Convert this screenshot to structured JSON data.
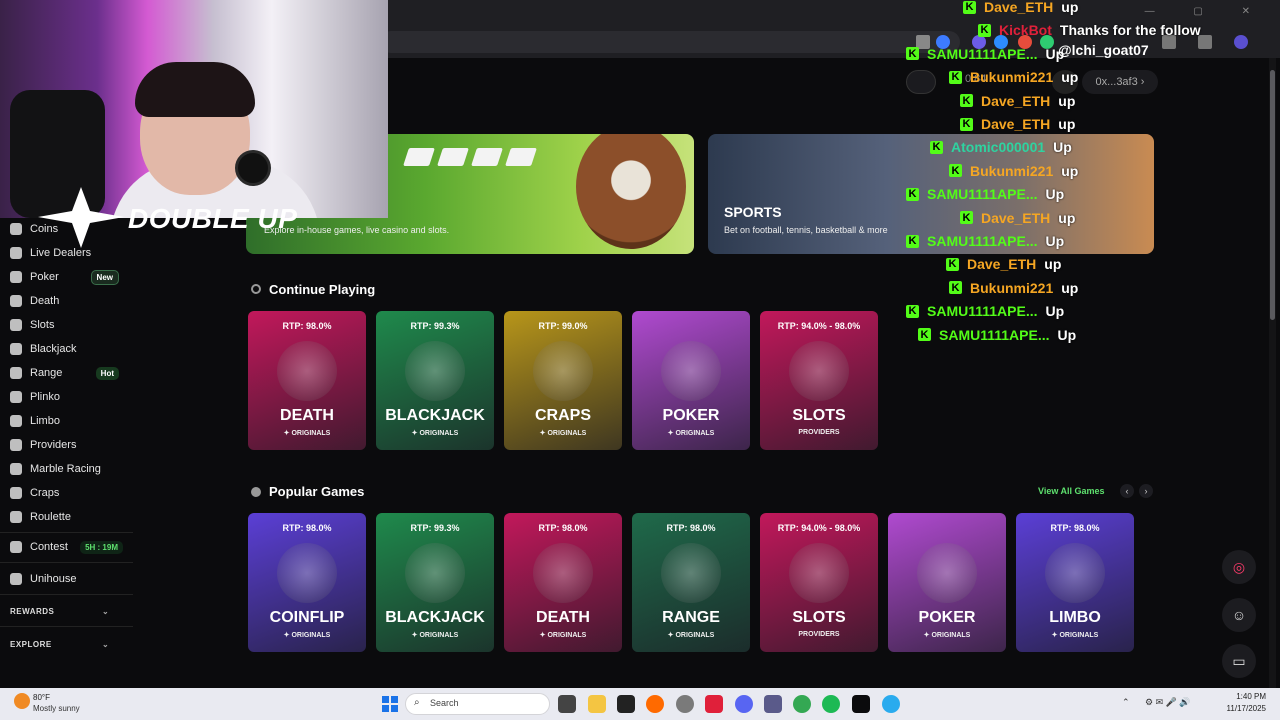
{
  "browser": {
    "window_controls": "— ▢ ✕"
  },
  "header": {
    "balance": "0.84",
    "wallet_label": "0x...3af3"
  },
  "logo": {
    "text": "DOUBLE UP"
  },
  "sidebar": {
    "items": [
      {
        "label": "Coins",
        "name": "coins"
      },
      {
        "label": "Live Dealers",
        "name": "live-dealers"
      },
      {
        "label": "Poker",
        "name": "poker",
        "badge": "New"
      },
      {
        "label": "Death",
        "name": "death"
      },
      {
        "label": "Slots",
        "name": "slots"
      },
      {
        "label": "Blackjack",
        "name": "blackjack"
      },
      {
        "label": "Range",
        "name": "range",
        "badge": "Hot"
      },
      {
        "label": "Plinko",
        "name": "plinko"
      },
      {
        "label": "Limbo",
        "name": "limbo"
      },
      {
        "label": "Providers",
        "name": "providers"
      },
      {
        "label": "Marble Racing",
        "name": "marble-racing"
      },
      {
        "label": "Craps",
        "name": "craps"
      },
      {
        "label": "Roulette",
        "name": "roulette"
      }
    ],
    "contest": {
      "label": "Contest",
      "timer": "5H : 19M"
    },
    "unihouse": {
      "label": "Unihouse"
    },
    "rewards": "REWARDS",
    "explore": "EXPLORE"
  },
  "banners": {
    "casino": {
      "subtitle": "Explore in-house games, live casino and slots."
    },
    "sports": {
      "title": "SPORTS",
      "subtitle": "Bet on football, tennis, basketball & more"
    }
  },
  "continue_playing": {
    "title": "Continue Playing",
    "tiles": [
      {
        "rtp": "RTP: 98.0%",
        "name": "DEATH",
        "sub": "✦ ORIGINALS",
        "color": "#c2185b"
      },
      {
        "rtp": "RTP: 99.3%",
        "name": "BLACKJACK",
        "sub": "✦ ORIGINALS",
        "color": "#1f8a4c"
      },
      {
        "rtp": "RTP: 99.0%",
        "name": "CRAPS",
        "sub": "✦ ORIGINALS",
        "color": "#b8961a"
      },
      {
        "rtp": "",
        "name": "POKER",
        "sub": "✦ ORIGINALS",
        "color": "#b04ad0"
      },
      {
        "rtp": "RTP: 94.0% - 98.0%",
        "name": "SLOTS",
        "sub": "PROVIDERS",
        "color": "#c2185b"
      }
    ]
  },
  "popular_games": {
    "title": "Popular Games",
    "view_all": "View All Games",
    "tiles": [
      {
        "rtp": "RTP: 98.0%",
        "name": "COINFLIP",
        "sub": "✦ ORIGINALS",
        "color": "#5b3fd6"
      },
      {
        "rtp": "RTP: 99.3%",
        "name": "BLACKJACK",
        "sub": "✦ ORIGINALS",
        "color": "#1f8a4c"
      },
      {
        "rtp": "RTP: 98.0%",
        "name": "DEATH",
        "sub": "✦ ORIGINALS",
        "color": "#c2185b"
      },
      {
        "rtp": "RTP: 98.0%",
        "name": "RANGE",
        "sub": "✦ ORIGINALS",
        "color": "#1f6a4a"
      },
      {
        "rtp": "RTP: 94.0% - 98.0%",
        "name": "SLOTS",
        "sub": "PROVIDERS",
        "color": "#c2185b"
      },
      {
        "rtp": "",
        "name": "POKER",
        "sub": "✦ ORIGINALS",
        "color": "#b04ad0"
      },
      {
        "rtp": "RTP: 98.0%",
        "name": "LIMBO",
        "sub": "✦ ORIGINALS",
        "color": "#5b3fd6"
      }
    ]
  },
  "chat": {
    "messages": [
      {
        "user": "Dave_ETH",
        "color": "#f5a623",
        "msg": "up"
      },
      {
        "user": "KickBot",
        "color": "#e0203a",
        "msg": "Thanks for the follow"
      },
      {
        "user": "SAMU1111APE...",
        "color": "#53fc18",
        "msg": "Up"
      },
      {
        "user": "Bukunmi221",
        "color": "#f5a623",
        "msg": "up"
      },
      {
        "user": "Dave_ETH",
        "color": "#f5a623",
        "msg": "up"
      },
      {
        "user": "Dave_ETH",
        "color": "#f5a623",
        "msg": "up"
      },
      {
        "user": "Atomic000001",
        "color": "#2ed3a0",
        "msg": "Up"
      },
      {
        "user": "Bukunmi221",
        "color": "#f5a623",
        "msg": "up"
      },
      {
        "user": "SAMU1111APE...",
        "color": "#53fc18",
        "msg": "Up"
      },
      {
        "user": "Dave_ETH",
        "color": "#f5a623",
        "msg": "up"
      },
      {
        "user": "SAMU1111APE...",
        "color": "#53fc18",
        "msg": "Up"
      },
      {
        "user": "Dave_ETH",
        "color": "#f5a623",
        "msg": "up"
      },
      {
        "user": "Bukunmi221",
        "color": "#f5a623",
        "msg": "up"
      },
      {
        "user": "SAMU1111APE...",
        "color": "#53fc18",
        "msg": "Up"
      },
      {
        "user": "SAMU1111APE...",
        "color": "#53fc18",
        "msg": "Up"
      }
    ],
    "follow_handle": "@lchi_goat07"
  },
  "taskbar": {
    "weather_temp": "80°F",
    "weather_desc": "Mostly sunny",
    "search_placeholder": "Search",
    "time": "1:40 PM",
    "date": "11/17/2025"
  },
  "colors": {
    "accent": "#5ee06e",
    "kick_green": "#53fc18"
  }
}
